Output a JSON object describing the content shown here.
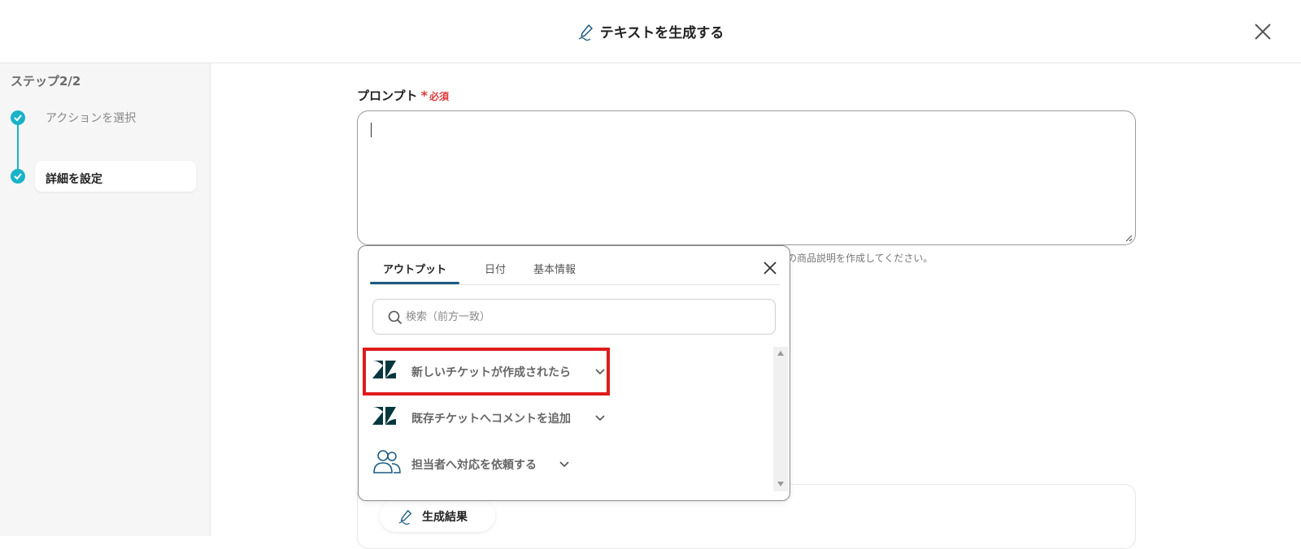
{
  "header": {
    "title": "テキストを生成する"
  },
  "sidebar": {
    "step_title": "ステップ2/2",
    "steps": [
      {
        "label": "アクションを選択"
      },
      {
        "label": "詳細を設定"
      }
    ]
  },
  "prompt": {
    "label": "プロンプト",
    "required_star": "*",
    "required_text": "必須",
    "hint_partial": "の商品説明を作成してください。"
  },
  "dropdown": {
    "tabs": [
      {
        "label": "アウトプット"
      },
      {
        "label": "日付"
      },
      {
        "label": "基本情報"
      }
    ],
    "search_placeholder": "検索（前方一致）",
    "items": [
      {
        "label": "新しいチケットが作成されたら",
        "icon": "zendesk-icon"
      },
      {
        "label": "既存チケットへコメントを追加",
        "icon": "zendesk-icon"
      },
      {
        "label": "担当者へ対応を依頼する",
        "icon": "people-icon"
      }
    ]
  },
  "result": {
    "label": "生成結果"
  },
  "colors": {
    "accent": "#19b3c8",
    "tab_underline": "#1c5a82",
    "highlight": "#e01b1b",
    "required": "#e03a3a"
  }
}
